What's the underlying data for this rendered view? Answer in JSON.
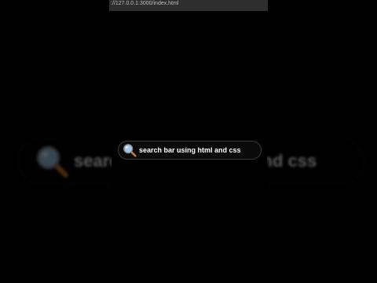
{
  "browser": {
    "url": "://127.0.0.1:3000/index.html"
  },
  "search": {
    "icon": "magnifying-glass-icon",
    "text": "search bar using html and css"
  },
  "background_copy": {
    "text_left": "searc",
    "text_right": "nd css"
  },
  "colors": {
    "background": "#000000",
    "text": "#ffffff",
    "border": "#3a3a3a",
    "lens": "#9fc8ee",
    "handle": "#c8772e"
  }
}
